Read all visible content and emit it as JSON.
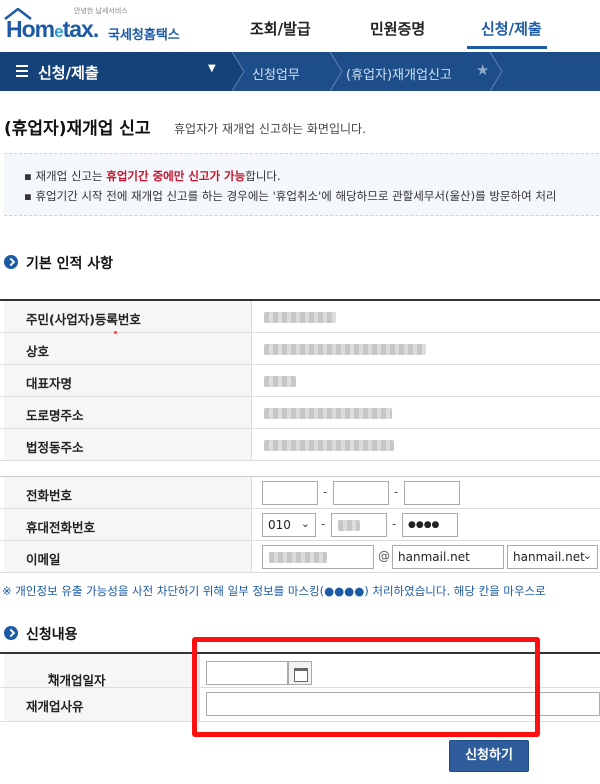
{
  "header": {
    "logo_tagline": "안녕한 납세서비스",
    "logo_home": "Hom",
    "logo_e": "e",
    "logo_tax": "tax.",
    "logo_korean": "국세청홈택스",
    "nav": [
      "조회/발급",
      "민원증명",
      "신청/제출"
    ],
    "active_nav": "신청/제출"
  },
  "location": {
    "menu_title": "신청/제출",
    "crumbs": [
      "신청업무",
      "(휴업자)재개업신고"
    ]
  },
  "page": {
    "title": "(휴업자)재개업 신고",
    "description": "휴업자가 재개업 신고하는 화면입니다."
  },
  "notice": {
    "line1_pre": "재개업 신고는 ",
    "line1_red": "휴업기간 중에만 신고가 가능",
    "line1_post": "합니다.",
    "line2": "휴업기간 시작 전에 재개업 신고를 하는 경우에는 '휴업취소'에 해당하므로 관할세무서(울산)를 방문하여 처리"
  },
  "basic": {
    "heading": "기본 인적 사항",
    "rows": [
      "주민(사업자)등록번호",
      "상호",
      "대표자명",
      "도로명주소",
      "법정동주소"
    ]
  },
  "contact": {
    "phone_label": "전화번호",
    "mobile_label": "휴대전화번호",
    "mobile_prefix": "010",
    "mobile_last": "●●●●",
    "email_label": "이메일",
    "email_at": "@",
    "email_domain": "hanmail.net",
    "email_domain_select": "hanmail.net"
  },
  "privacy_note": "※ 개인정보 유출 가능성을 사전 차단하기 위해 일부 정보를 마스킹(●●●●) 처리하였습니다. 해당 칸을 마우스로",
  "apply": {
    "heading": "신청내용",
    "reopen_date_label": "재개업일자",
    "reopen_reason_label": "재개업사유",
    "required_mark": "*"
  },
  "submit_label": "신청하기",
  "colors": {
    "brand": "#1d5aa6",
    "locbar": "#1d4e8a",
    "highlight": "#ff1010",
    "required": "#c8142c"
  }
}
